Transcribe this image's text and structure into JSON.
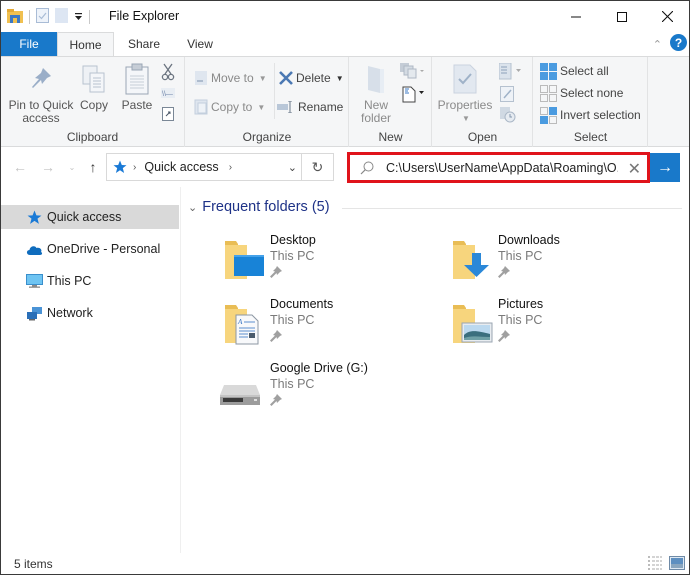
{
  "window": {
    "title": "File Explorer",
    "controls": {
      "minimize": "minimize-icon",
      "maximize": "maximize-icon",
      "close": "close-icon"
    }
  },
  "quick_access_toolbar": {
    "icons": [
      "folder-icon",
      "properties-icon",
      "new-folder-icon",
      "customize-dropdown-icon"
    ]
  },
  "ribbon": {
    "tabs": [
      {
        "label": "File",
        "active": false
      },
      {
        "label": "Home",
        "active": true
      },
      {
        "label": "Share",
        "active": false
      },
      {
        "label": "View",
        "active": false
      }
    ],
    "groups": {
      "clipboard": {
        "label": "Clipboard",
        "pin": "Pin to Quick access",
        "pin_line1": "Pin to Quick",
        "pin_line2": "access",
        "copy": "Copy",
        "paste": "Paste"
      },
      "organize": {
        "label": "Organize",
        "move_to": "Move to",
        "copy_to": "Copy to",
        "delete": "Delete",
        "rename": "Rename"
      },
      "new": {
        "label": "New",
        "new_folder_line1": "New",
        "new_folder_line2": "folder"
      },
      "open": {
        "label": "Open",
        "properties": "Properties"
      },
      "select": {
        "label": "Select",
        "select_all": "Select all",
        "select_none": "Select none",
        "invert_selection": "Invert selection"
      }
    }
  },
  "navigation": {
    "breadcrumb": [
      "Quick access"
    ],
    "search_value": "C:\\Users\\UserName\\AppData\\Roaming\\O...",
    "search_highlight_color": "#e0131b"
  },
  "sidebar": {
    "items": [
      {
        "label": "Quick access",
        "icon": "star-icon",
        "active": true
      },
      {
        "label": "OneDrive - Personal",
        "icon": "cloud-icon",
        "active": false
      },
      {
        "label": "This PC",
        "icon": "monitor-icon",
        "active": false
      },
      {
        "label": "Network",
        "icon": "network-icon",
        "active": false
      }
    ]
  },
  "content": {
    "section_title": "Frequent folders (5)",
    "folders": [
      {
        "name": "Desktop",
        "location": "This PC",
        "icon": "desktop-folder-icon",
        "pinned": true
      },
      {
        "name": "Downloads",
        "location": "This PC",
        "icon": "downloads-folder-icon",
        "pinned": true
      },
      {
        "name": "Documents",
        "location": "This PC",
        "icon": "documents-folder-icon",
        "pinned": true
      },
      {
        "name": "Pictures",
        "location": "This PC",
        "icon": "pictures-folder-icon",
        "pinned": true
      },
      {
        "name": "Google Drive (G:)",
        "location": "This PC",
        "icon": "drive-icon",
        "pinned": true
      }
    ]
  },
  "status": {
    "item_count": "5 items"
  },
  "colors": {
    "accent": "#1979ca",
    "section_title": "#1e3287"
  }
}
